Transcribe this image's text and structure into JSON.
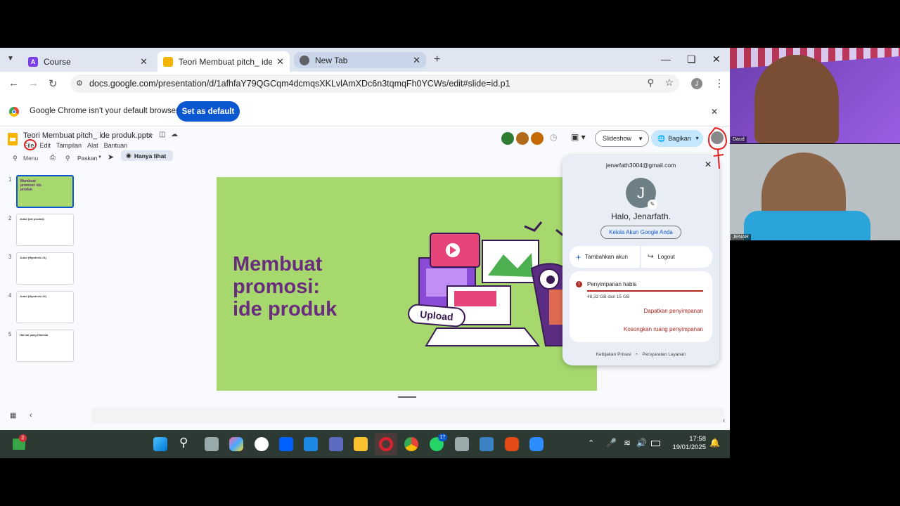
{
  "browser": {
    "tabs": [
      {
        "label": "Course",
        "icon": "brightspace-icon"
      },
      {
        "label": "Teori Membuat pitch_ ide produk",
        "icon": "slides-icon"
      },
      {
        "label": "New Tab",
        "icon": "chrome-icon"
      }
    ],
    "url": "docs.google.com/presentation/d/1afhfaY79QGCqm4dcmqsXKLvlAmXDc6n3tqmqFh0YCWs/edit#slide=id.p1",
    "profile_initial": "J"
  },
  "infobar": {
    "message": "Google Chrome isn't your default browser",
    "button": "Set as default"
  },
  "doc": {
    "title": "Teori Membuat pitch_ ide produk.pptx",
    "menus": [
      "File",
      "Edit",
      "Tampilan",
      "Alat",
      "Bantuan"
    ],
    "search_label": "Menu",
    "zoom_label": "Paskan",
    "view_mode": "Hanya lihat",
    "slideshow": "Slideshow",
    "share": "Bagikan"
  },
  "slides": [
    {
      "num": "1",
      "title": "Membuat promosi: ide produk"
    },
    {
      "num": "2",
      "title": "Judul (ide produk)"
    },
    {
      "num": "3",
      "title": "Judul (Hipotesis #1)"
    },
    {
      "num": "4",
      "title": "Judul (Hipotesis #2)"
    },
    {
      "num": "5",
      "title": "Hal-hal yang Dikelola"
    }
  ],
  "slide": {
    "line1": "Membuat",
    "line2": "promosi:",
    "line3": "ide produk",
    "upload": "Upload",
    "bg_color": "#a6d86e",
    "text_color": "#6a2c7e"
  },
  "account": {
    "email": "jenarfath3004@gmail.com",
    "initial": "J",
    "greeting": "Halo, Jenarfath.",
    "manage": "Kelola Akun Google Anda",
    "add_account": "Tambahkan akun",
    "logout": "Logout",
    "storage_title": "Penyimpanan habis",
    "storage_detail": "48,32 GB dari 15 GB",
    "get_storage": "Dapatkan penyimpanan",
    "empty_storage": "Kosongkan ruang penyimpanan",
    "privacy": "Kebijakan Privasi",
    "separator": "•",
    "terms": "Persyaratan Layanan"
  },
  "taskbar": {
    "time": "17:58",
    "date": "19/01/2025",
    "badge_left": "2",
    "badge_whatsapp": "17"
  },
  "video": {
    "top_name": "Daud",
    "bottom_name": "JENAR"
  }
}
